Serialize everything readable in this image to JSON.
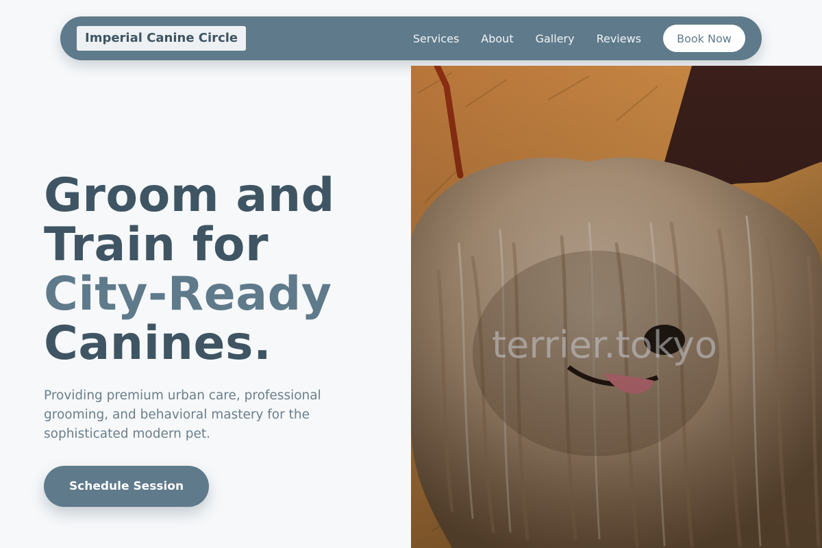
{
  "nav": {
    "brand": "Imperial Canine Circle",
    "links": [
      "Services",
      "About",
      "Gallery",
      "Reviews"
    ],
    "book_label": "Book Now"
  },
  "hero": {
    "title_lines": [
      "Groom and",
      "Train for",
      "City-Ready",
      "Canines."
    ],
    "subtitle": "Providing premium urban care, professional grooming, and behavioral mastery for the sophisticated modern pet.",
    "cta_label": "Schedule Session",
    "image_watermark": "terrier.tokyo"
  },
  "colors": {
    "primary": "#5f7a8a",
    "heading": "#3f5563",
    "background": "#f6f8fa",
    "body_text": "#6b7e8a"
  }
}
